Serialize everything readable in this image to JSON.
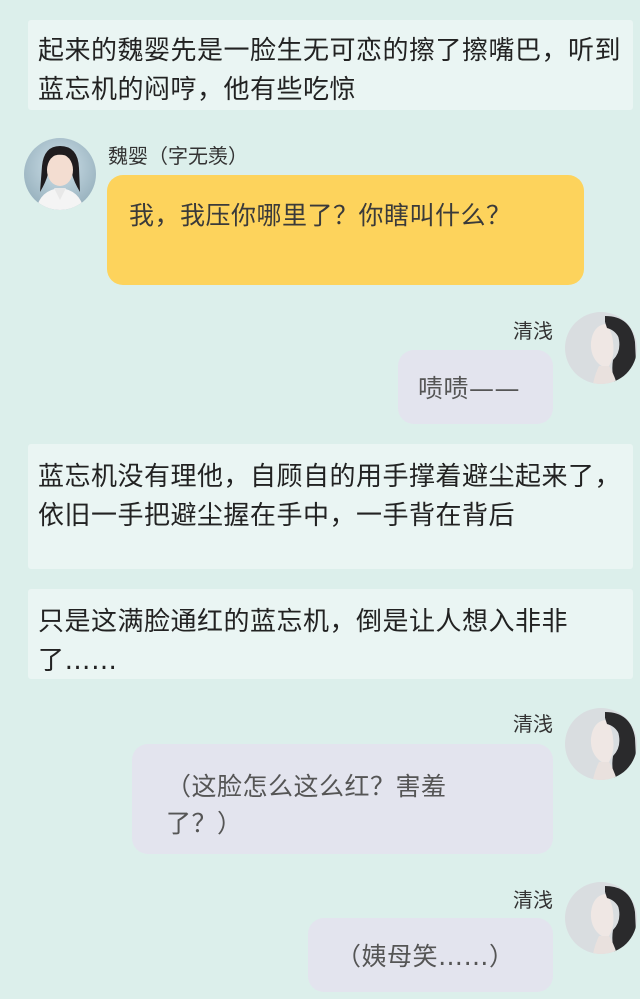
{
  "messages": {
    "narration1": "起来的魏婴先是一脸生无可恋的擦了擦嘴巴，听到蓝忘机的闷哼，他有些吃惊",
    "wei_name": "魏婴（字无羡）",
    "wei_bubble": "我，我压你哪里了？你瞎叫什么？",
    "qing_name_1": "清浅",
    "qing_bubble_1": "啧啧——",
    "narration2": "蓝忘机没有理他，自顾自的用手撑着避尘起来了，依旧一手把避尘握在手中，一手背在背后",
    "narration3": "只是这满脸通红的蓝忘机，倒是让人想入非非了……",
    "qing_name_2": "清浅",
    "qing_bubble_2": "（这脸怎么这么红？害羞了？）",
    "qing_name_3": "清浅",
    "qing_bubble_3": "（姨母笑……）"
  },
  "colors": {
    "background": "#dcefeb",
    "narration_bg": "#eaf5f3",
    "yellow_bubble": "#fdd35c",
    "gray_bubble": "#e3e4ee"
  },
  "icons": {
    "wei_avatar": "avatar-wei-ying",
    "qing_avatar": "avatar-qing-qian"
  }
}
